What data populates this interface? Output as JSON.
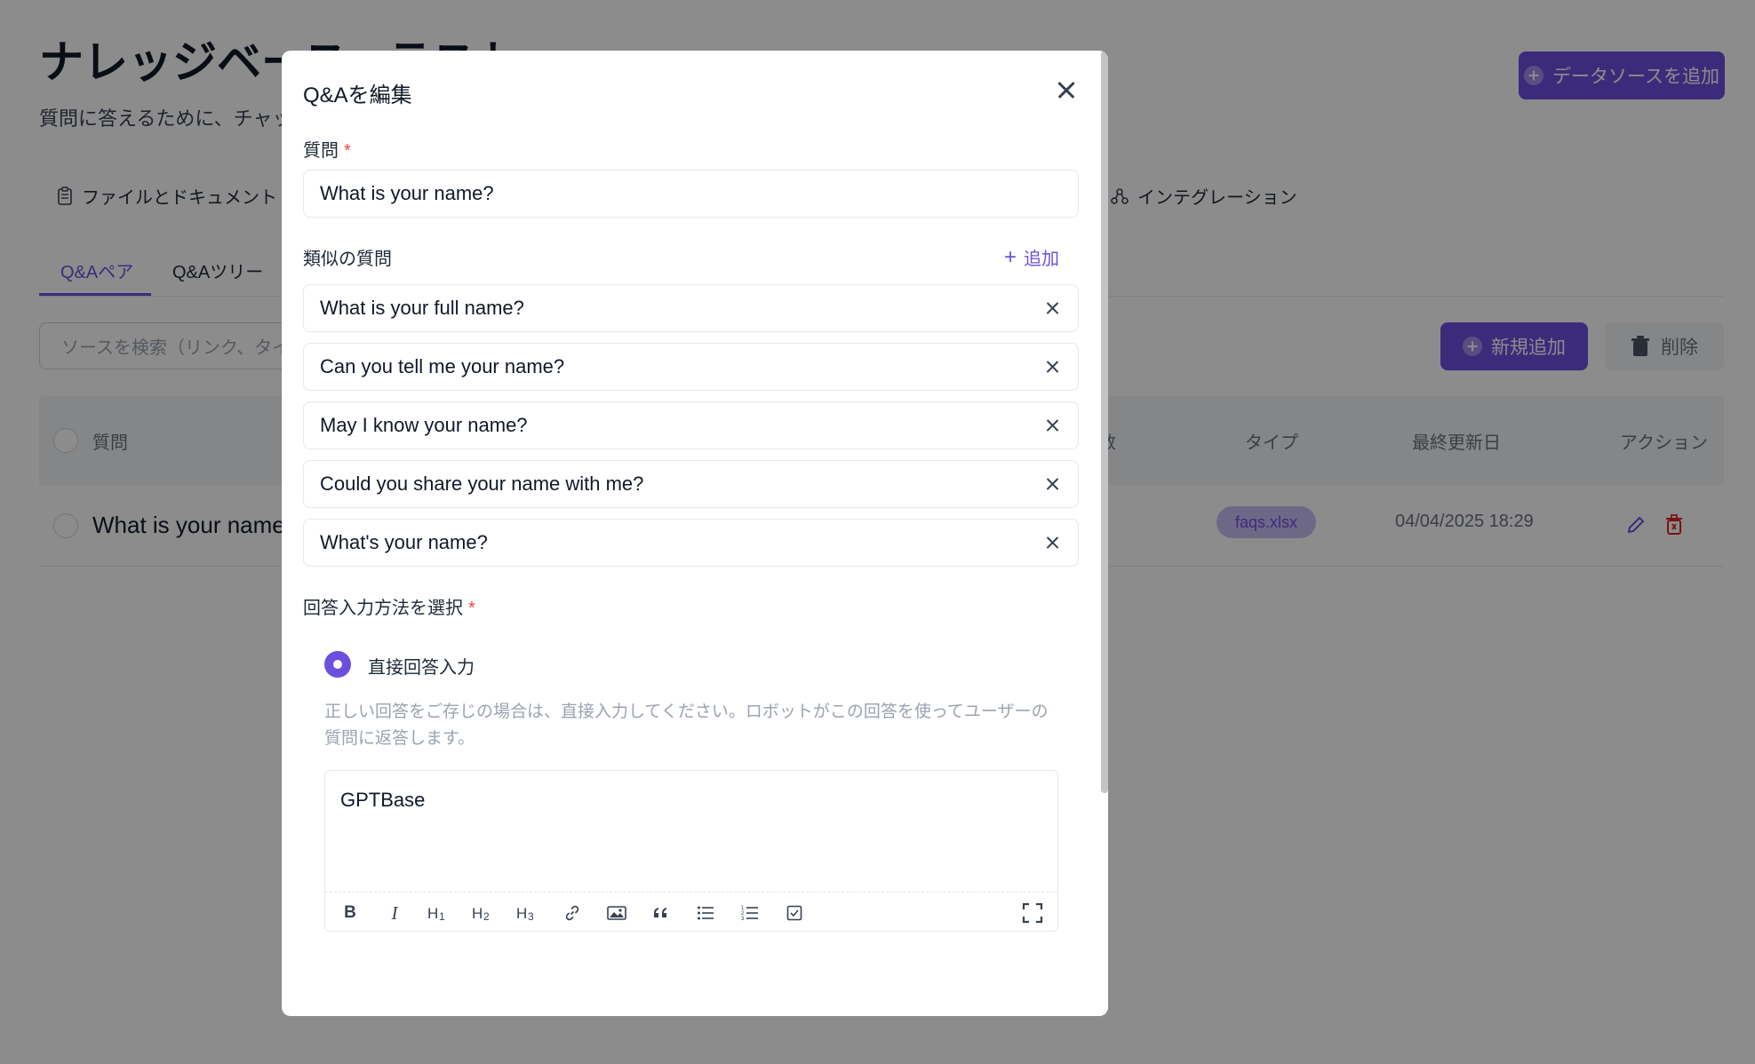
{
  "background": {
    "page_title": "ナレッジベース › テスト",
    "page_subtitle": "質問に答えるために、チャットボ",
    "add_source_label": "データソースを追加",
    "nav_tabs": [
      {
        "label": "ファイルとドキュメント",
        "icon": "document-icon"
      },
      {
        "label": "インテグレーション",
        "icon": "integration-icon"
      }
    ],
    "sub_tabs": [
      "Q&Aペア",
      "Q&Aツリー"
    ],
    "search_placeholder": "ソースを検索（リンク、タイトル",
    "new_button_label": "新規追加",
    "delete_button_label": "削除",
    "columns": {
      "question": "質問",
      "count_fragment": "数",
      "type": "タイプ",
      "updated": "最終更新日",
      "actions": "アクション"
    },
    "rows": [
      {
        "question": "What is your name?",
        "type": "faqs.xlsx",
        "updated": "04/04/2025 18:29"
      }
    ]
  },
  "modal": {
    "title": "Q&Aを編集",
    "question_label": "質問",
    "question_value": "What is your name?",
    "similar_label": "類似の質問",
    "add_label": "追加",
    "similar_questions": [
      "What is your full name?",
      "Can you tell me your name?",
      "May I know your name?",
      "Could you share your name with me?",
      "What's your name?"
    ],
    "answer_method_label": "回答入力方法を選択",
    "required_mark": "*",
    "direct_answer_label": "直接回答入力",
    "direct_answer_help": "正しい回答をご存じの場合は、直接入力してください。ロボットがこの回答を使ってユーザーの質問に返答します。",
    "answer_content": "GPTBase",
    "toolbar": [
      "B",
      "I",
      "H1",
      "H2",
      "H3",
      "link",
      "image",
      "quote",
      "bullet-list",
      "ordered-list",
      "task-list",
      "fullscreen"
    ]
  },
  "colors": {
    "accent": "#6d4fe0",
    "required": "#ef4444",
    "overlay": "rgba(0,0,0,0.45)"
  }
}
